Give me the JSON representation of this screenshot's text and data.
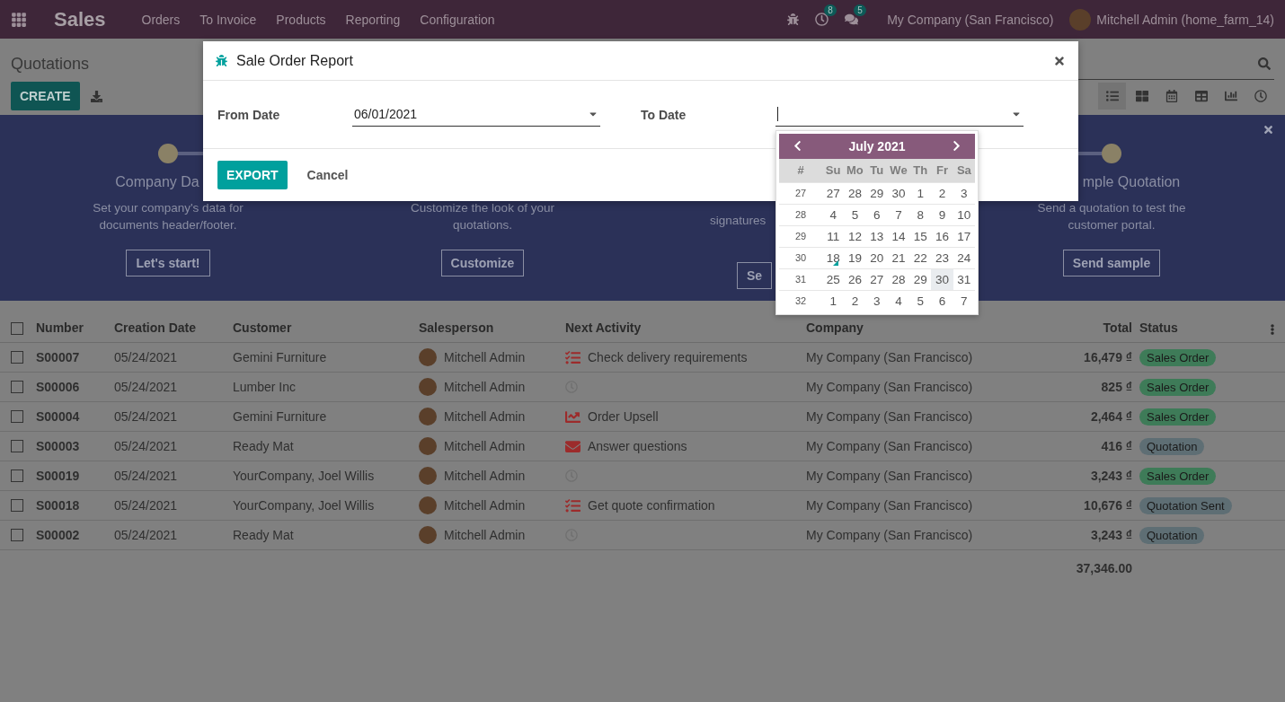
{
  "navbar": {
    "app": "Sales",
    "menu": [
      "Orders",
      "To Invoice",
      "Products",
      "Reporting",
      "Configuration"
    ],
    "activity_count": "8",
    "message_count": "5",
    "company": "My Company (San Francisco)",
    "user": "Mitchell Admin (home_farm_14)"
  },
  "breadcrumb": "Quotations",
  "create_button": "CREATE",
  "views": [
    {
      "kind": "list",
      "selected": true
    },
    {
      "kind": "kanban",
      "selected": false
    },
    {
      "kind": "calendar",
      "selected": false
    },
    {
      "kind": "pivot",
      "selected": false
    },
    {
      "kind": "graph",
      "selected": false
    },
    {
      "kind": "activity",
      "selected": false
    }
  ],
  "banner": {
    "steps": [
      {
        "title": "Company Da",
        "description": "Set your company's data for documents header/footer.",
        "button": "Let's start!"
      },
      {
        "description": "Customize the look of your quotations.",
        "button": "Customize"
      },
      {
        "description": "signatures",
        "button": "Se"
      },
      {
        "title": "mple Quotation",
        "description": "Send a quotation to test the customer portal.",
        "button": "Send sample"
      }
    ]
  },
  "table": {
    "select_all_checked": false,
    "columns": [
      "Number",
      "Creation Date",
      "Customer",
      "Salesperson",
      "Next Activity",
      "Company",
      "Total",
      "Status"
    ],
    "rows": [
      {
        "checked": false,
        "number": "S00007",
        "date": "05/24/2021",
        "customer": "Gemini Furniture",
        "salesperson": "Mitchell Admin",
        "activity": {
          "kind": "tasks",
          "text": "Check delivery requirements"
        },
        "company": "My Company (San Francisco)",
        "total": "16,479 ₫",
        "status": {
          "label": "Sales Order",
          "kind": "order"
        }
      },
      {
        "checked": false,
        "number": "S00006",
        "date": "05/24/2021",
        "customer": "Lumber Inc",
        "salesperson": "Mitchell Admin",
        "activity": {
          "kind": "none"
        },
        "company": "My Company (San Francisco)",
        "total": "825 ₫",
        "status": {
          "label": "Sales Order",
          "kind": "order"
        }
      },
      {
        "checked": false,
        "number": "S00004",
        "date": "05/24/2021",
        "customer": "Gemini Furniture",
        "salesperson": "Mitchell Admin",
        "activity": {
          "kind": "upsell",
          "text": "Order Upsell"
        },
        "company": "My Company (San Francisco)",
        "total": "2,464 ₫",
        "status": {
          "label": "Sales Order",
          "kind": "order"
        }
      },
      {
        "checked": false,
        "number": "S00003",
        "date": "05/24/2021",
        "customer": "Ready Mat",
        "salesperson": "Mitchell Admin",
        "activity": {
          "kind": "email",
          "text": "Answer questions"
        },
        "company": "My Company (San Francisco)",
        "total": "416 ₫",
        "status": {
          "label": "Quotation",
          "kind": "draft"
        }
      },
      {
        "checked": false,
        "number": "S00019",
        "date": "05/24/2021",
        "customer": "YourCompany, Joel Willis",
        "salesperson": "Mitchell Admin",
        "activity": {
          "kind": "none"
        },
        "company": "My Company (San Francisco)",
        "total": "3,243 ₫",
        "status": {
          "label": "Sales Order",
          "kind": "order"
        }
      },
      {
        "checked": false,
        "number": "S00018",
        "date": "05/24/2021",
        "customer": "YourCompany, Joel Willis",
        "salesperson": "Mitchell Admin",
        "activity": {
          "kind": "tasks",
          "text": "Get quote confirmation"
        },
        "company": "My Company (San Francisco)",
        "total": "10,676 ₫",
        "status": {
          "label": "Quotation Sent",
          "kind": "draft"
        }
      },
      {
        "checked": false,
        "number": "S00002",
        "date": "05/24/2021",
        "customer": "Ready Mat",
        "salesperson": "Mitchell Admin",
        "activity": {
          "kind": "none"
        },
        "company": "My Company (San Francisco)",
        "total": "3,243 ₫",
        "status": {
          "label": "Quotation",
          "kind": "draft"
        }
      }
    ],
    "grand_total": "37,346.00"
  },
  "dialog": {
    "title": "Sale Order Report",
    "from_date": {
      "label": "From Date",
      "value": "06/01/2021"
    },
    "to_date": {
      "label": "To Date",
      "focused": true
    },
    "export_button": "EXPORT",
    "cancel_button": "Cancel",
    "datepicker": {
      "month": "July 2021",
      "weekdays": [
        "#",
        "Su",
        "Mo",
        "Tu",
        "We",
        "Th",
        "Fr",
        "Sa"
      ],
      "weeks": [
        {
          "week": "27",
          "days": [
            {
              "label": "27",
              "selected": false,
              "today": false
            },
            {
              "label": "28",
              "selected": false,
              "today": false
            },
            {
              "label": "29",
              "selected": false,
              "today": false
            },
            {
              "label": "30",
              "selected": false,
              "today": false
            },
            {
              "label": "1",
              "selected": false,
              "today": false
            },
            {
              "label": "2",
              "selected": false,
              "today": false
            },
            {
              "label": "3",
              "selected": false,
              "today": false
            }
          ]
        },
        {
          "week": "28",
          "days": [
            {
              "label": "4",
              "selected": false,
              "today": false
            },
            {
              "label": "5",
              "selected": false,
              "today": false
            },
            {
              "label": "6",
              "selected": false,
              "today": false
            },
            {
              "label": "7",
              "selected": false,
              "today": false
            },
            {
              "label": "8",
              "selected": false,
              "today": false
            },
            {
              "label": "9",
              "selected": false,
              "today": false
            },
            {
              "label": "10",
              "selected": false,
              "today": false
            }
          ]
        },
        {
          "week": "29",
          "days": [
            {
              "label": "11",
              "selected": false,
              "today": false
            },
            {
              "label": "12",
              "selected": false,
              "today": false
            },
            {
              "label": "13",
              "selected": false,
              "today": false
            },
            {
              "label": "14",
              "selected": false,
              "today": false
            },
            {
              "label": "15",
              "selected": false,
              "today": false
            },
            {
              "label": "16",
              "selected": false,
              "today": false
            },
            {
              "label": "17",
              "selected": false,
              "today": false
            }
          ]
        },
        {
          "week": "30",
          "days": [
            {
              "label": "18",
              "selected": false,
              "today": true
            },
            {
              "label": "19",
              "selected": false,
              "today": false
            },
            {
              "label": "20",
              "selected": false,
              "today": false
            },
            {
              "label": "21",
              "selected": false,
              "today": false
            },
            {
              "label": "22",
              "selected": false,
              "today": false
            },
            {
              "label": "23",
              "selected": false,
              "today": false
            },
            {
              "label": "24",
              "selected": false,
              "today": false
            }
          ]
        },
        {
          "week": "31",
          "days": [
            {
              "label": "25",
              "selected": false,
              "today": false
            },
            {
              "label": "26",
              "selected": false,
              "today": false
            },
            {
              "label": "27",
              "selected": false,
              "today": false
            },
            {
              "label": "28",
              "selected": false,
              "today": false
            },
            {
              "label": "29",
              "selected": false,
              "today": false
            },
            {
              "label": "30",
              "selected": true,
              "today": false
            },
            {
              "label": "31",
              "selected": false,
              "today": false
            }
          ]
        },
        {
          "week": "32",
          "days": [
            {
              "label": "1",
              "selected": false,
              "today": false
            },
            {
              "label": "2",
              "selected": false,
              "today": false
            },
            {
              "label": "3",
              "selected": false,
              "today": false
            },
            {
              "label": "4",
              "selected": false,
              "today": false
            },
            {
              "label": "5",
              "selected": false,
              "today": false
            },
            {
              "label": "6",
              "selected": false,
              "today": false
            },
            {
              "label": "7",
              "selected": false,
              "today": false
            }
          ]
        }
      ]
    }
  }
}
